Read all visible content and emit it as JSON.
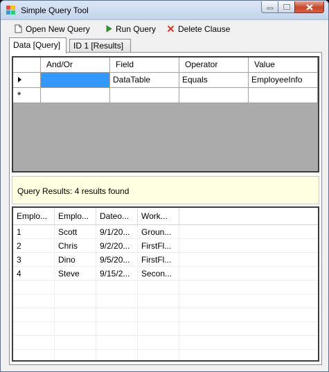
{
  "window": {
    "title": "Simple Query Tool"
  },
  "toolbar": {
    "open_label": "Open New Query",
    "run_label": "Run Query",
    "delete_label": "Delete Clause"
  },
  "tabs": [
    {
      "label": "Data [Query]"
    },
    {
      "label": "ID 1 [Results]"
    }
  ],
  "query_grid": {
    "columns": [
      "And/Or",
      "Field",
      "Operator",
      "Value"
    ],
    "rows": [
      [
        "",
        "DataTable",
        "Equals",
        "EmployeeInfo"
      ],
      [
        "",
        "",
        "",
        ""
      ]
    ],
    "new_row_marker": "*"
  },
  "results": {
    "summary": "Query Results: 4 results found",
    "columns": [
      "Emplo...",
      "Emplo...",
      "Dateo...",
      "Work..."
    ],
    "rows": [
      [
        "1",
        "Scott",
        "9/1/20...",
        "Groun..."
      ],
      [
        "2",
        "Chris",
        "9/2/20...",
        "FirstFl..."
      ],
      [
        "3",
        "Dino",
        "9/5/20...",
        "FirstFl..."
      ],
      [
        "4",
        "Steve",
        "9/15/2...",
        "Secon..."
      ]
    ]
  },
  "colors": {
    "selection": "#3399ff",
    "banner": "#ffffe1",
    "grid_background": "#ababab"
  }
}
